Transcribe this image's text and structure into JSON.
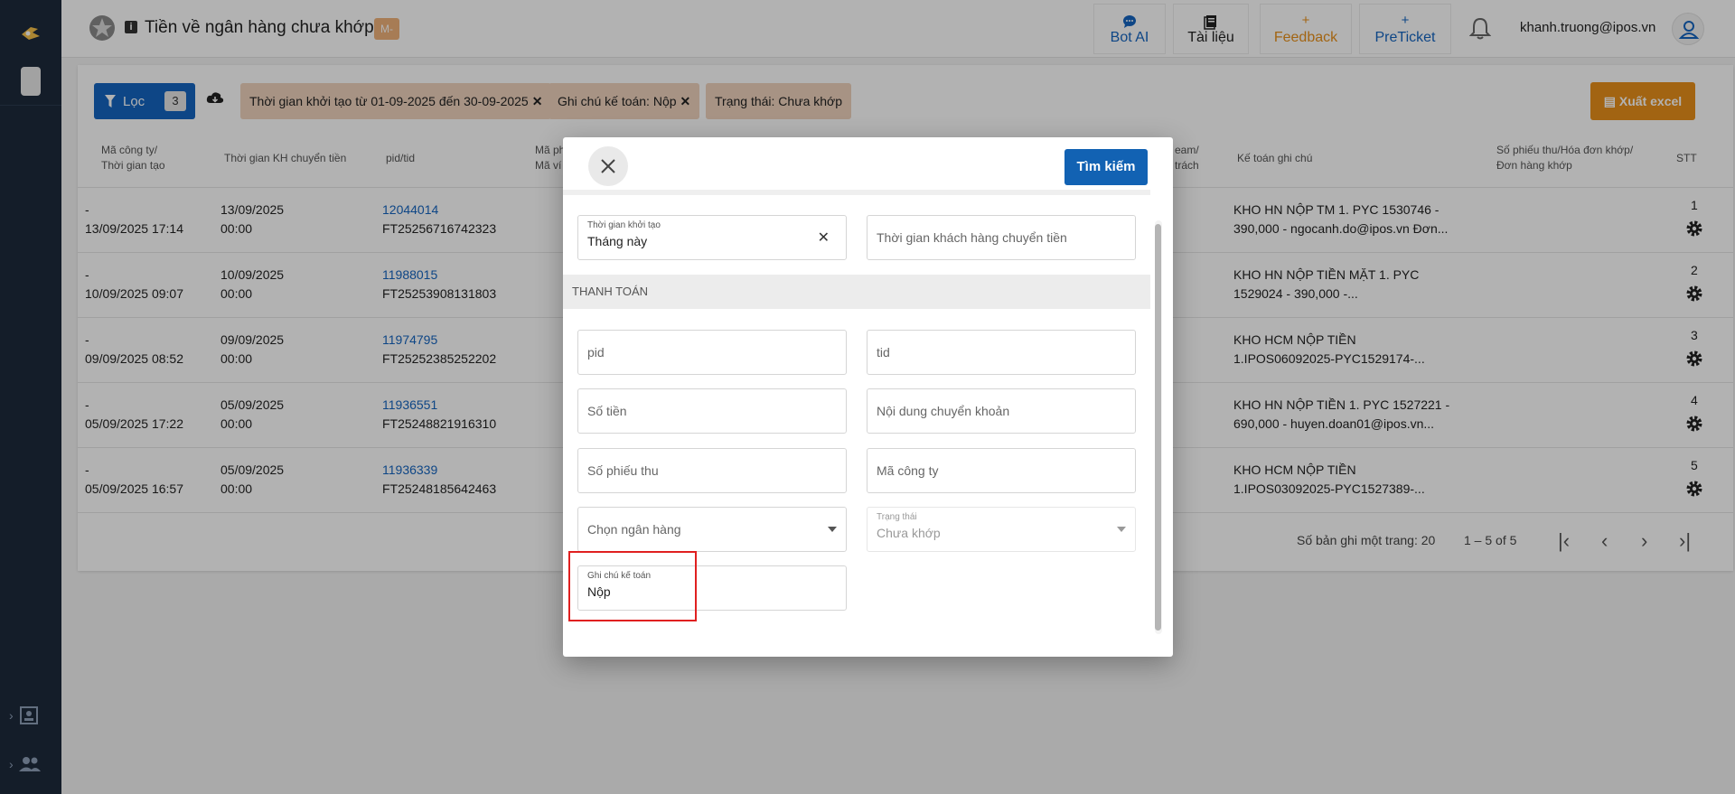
{
  "header": {
    "title": "Tiền về ngân hàng chưa khớp",
    "badge": "M-",
    "buttons": [
      {
        "icon": "chat-icon",
        "label": "Bot AI",
        "color": "#1565c0"
      },
      {
        "icon": "docs-icon",
        "label": "Tài liệu",
        "color": "#222222"
      },
      {
        "icon": "plus-icon",
        "label": "Feedback",
        "color": "#e8901a"
      },
      {
        "icon": "plus-icon",
        "label": "PreTicket",
        "color": "#1565c0"
      }
    ],
    "plus_glyph": "+",
    "user_email": "khanh.truong@ipos.vn"
  },
  "toolbar": {
    "filter_label": "Lọc",
    "filter_count": "3",
    "chips": [
      "Thời gian khởi tạo từ 01-09-2025 đến 30-09-2025",
      "Ghi chú kế toán: Nộp",
      "Trạng thái: Chưa khớp"
    ],
    "chip_close": "✕",
    "export_label": "Xuất excel"
  },
  "table": {
    "headers": {
      "company": [
        "Mã công ty/",
        "Thời gian tạo"
      ],
      "transfer_time": "Thời gian KH chuyển tiền",
      "pid_tid": "pid/tid",
      "payment_code": [
        "Mã ph",
        "Mã ví"
      ],
      "team": [
        "eam/",
        "trách"
      ],
      "accountant_note": "Kế toán ghi chú",
      "receipt": [
        "Số phiếu thu/Hóa đơn khớp/",
        "Đơn hàng khớp"
      ],
      "stt": "STT"
    },
    "rows": [
      {
        "company": "-",
        "created": "13/09/2025 17:14",
        "date": "13/09/2025",
        "time": "00:00",
        "pid": "12044014",
        "tid": "FT25256716742323",
        "note1": "KHO HN NỘP TM 1. PYC 1530746 -",
        "note2": "390,000 - ngocanh.do@ipos.vn Đơn...",
        "stt": "1"
      },
      {
        "company": "-",
        "created": "10/09/2025 09:07",
        "date": "10/09/2025",
        "time": "00:00",
        "pid": "11988015",
        "tid": "FT25253908131803",
        "note1": "KHO HN NỘP TIỀN MẶT 1. PYC",
        "note2": "1529024 - 390,000 -...",
        "stt": "2"
      },
      {
        "company": "-",
        "created": "09/09/2025 08:52",
        "date": "09/09/2025",
        "time": "00:00",
        "pid": "11974795",
        "tid": "FT25252385252202",
        "note1": "KHO HCM NỘP TIỀN",
        "note2": "1.IPOS06092025-PYC1529174-...",
        "stt": "3"
      },
      {
        "company": "-",
        "created": "05/09/2025 17:22",
        "date": "05/09/2025",
        "time": "00:00",
        "pid": "11936551",
        "tid": "FT25248821916310",
        "note1": "KHO HN NỘP TIỀN 1. PYC 1527221 -",
        "note2": "690,000 - huyen.doan01@ipos.vn...",
        "stt": "4"
      },
      {
        "company": "-",
        "created": "05/09/2025 16:57",
        "date": "05/09/2025",
        "time": "00:00",
        "pid": "11936339",
        "tid": "FT25248185642463",
        "note1": "KHO HCM NỘP TIỀN",
        "note2": "1.IPOS03092025-PYC1527389-...",
        "stt": "5"
      }
    ]
  },
  "pagination": {
    "rows_per_page": "Số bản ghi một trang: 20",
    "range": "1 – 5 of 5"
  },
  "modal": {
    "search_label": "Tìm kiếm",
    "section_payment": "THANH TOÁN",
    "fields": {
      "created_time": {
        "label": "Thời gian khởi tạo",
        "value": "Tháng này",
        "clear": "✕"
      },
      "customer_transfer_time": {
        "placeholder": "Thời gian khách hàng chuyển tiền"
      },
      "pid": {
        "placeholder": "pid"
      },
      "tid": {
        "placeholder": "tid"
      },
      "amount": {
        "placeholder": "Số tiền"
      },
      "transfer_content": {
        "placeholder": "Nội dung chuyển khoản"
      },
      "receipt_number": {
        "placeholder": "Số phiếu thu"
      },
      "company_code": {
        "placeholder": "Mã công ty"
      },
      "bank": {
        "placeholder": "Chọn ngân hàng"
      },
      "status": {
        "label": "Trạng thái",
        "value": "Chưa khớp"
      },
      "accountant_note": {
        "label": "Ghi chú kế toán",
        "value": "Nộp"
      }
    }
  }
}
